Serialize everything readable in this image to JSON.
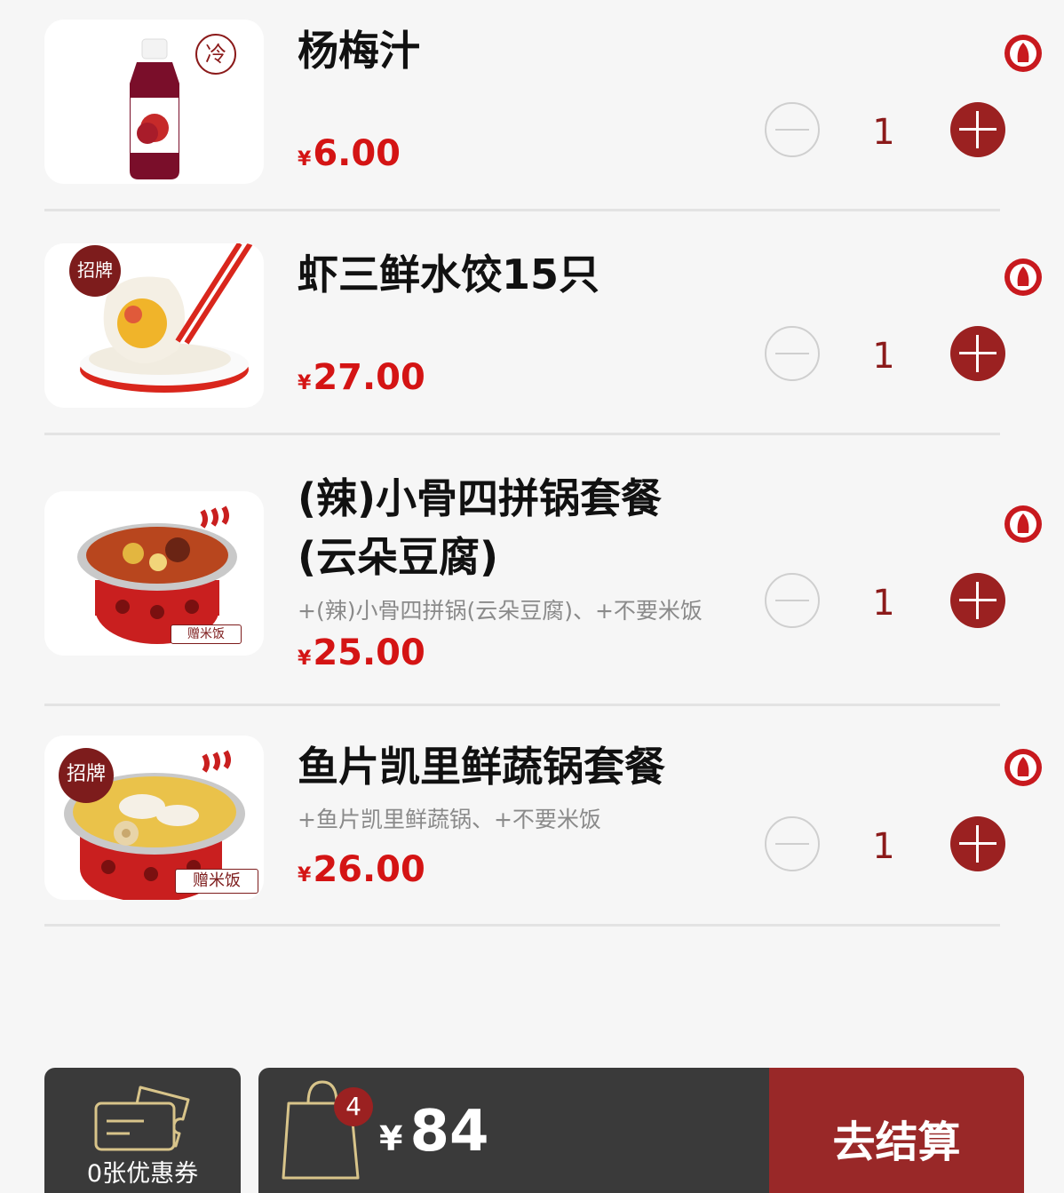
{
  "items": [
    {
      "name": "杨梅汁",
      "desc": "",
      "price": "6.00",
      "currency": "¥",
      "qty": "1",
      "badge": "冷"
    },
    {
      "name": "虾三鲜水饺15只",
      "desc": "",
      "price": "27.00",
      "currency": "¥",
      "qty": "1",
      "badge": "招牌"
    },
    {
      "name_line1": "(辣)小骨四拼锅套餐",
      "name_line2": "(云朵豆腐)",
      "desc": "+(辣)小骨四拼锅(云朵豆腐)、+不要米饭",
      "price": "25.00",
      "currency": "¥",
      "qty": "1",
      "tag": "赠米饭"
    },
    {
      "name": "鱼片凯里鲜蔬锅套餐",
      "desc": "+鱼片凯里鲜蔬锅、+不要米饭",
      "price": "26.00",
      "currency": "¥",
      "qty": "1",
      "badge": "招牌",
      "tag": "赠米饭"
    }
  ],
  "footer": {
    "coupon_label": "0张优惠券",
    "cart_count": "4",
    "currency": "¥",
    "total": "84",
    "checkout_label": "去结算"
  },
  "colors": {
    "accent": "#9b2121",
    "price": "#d41414",
    "bar": "#3a3a3a"
  }
}
